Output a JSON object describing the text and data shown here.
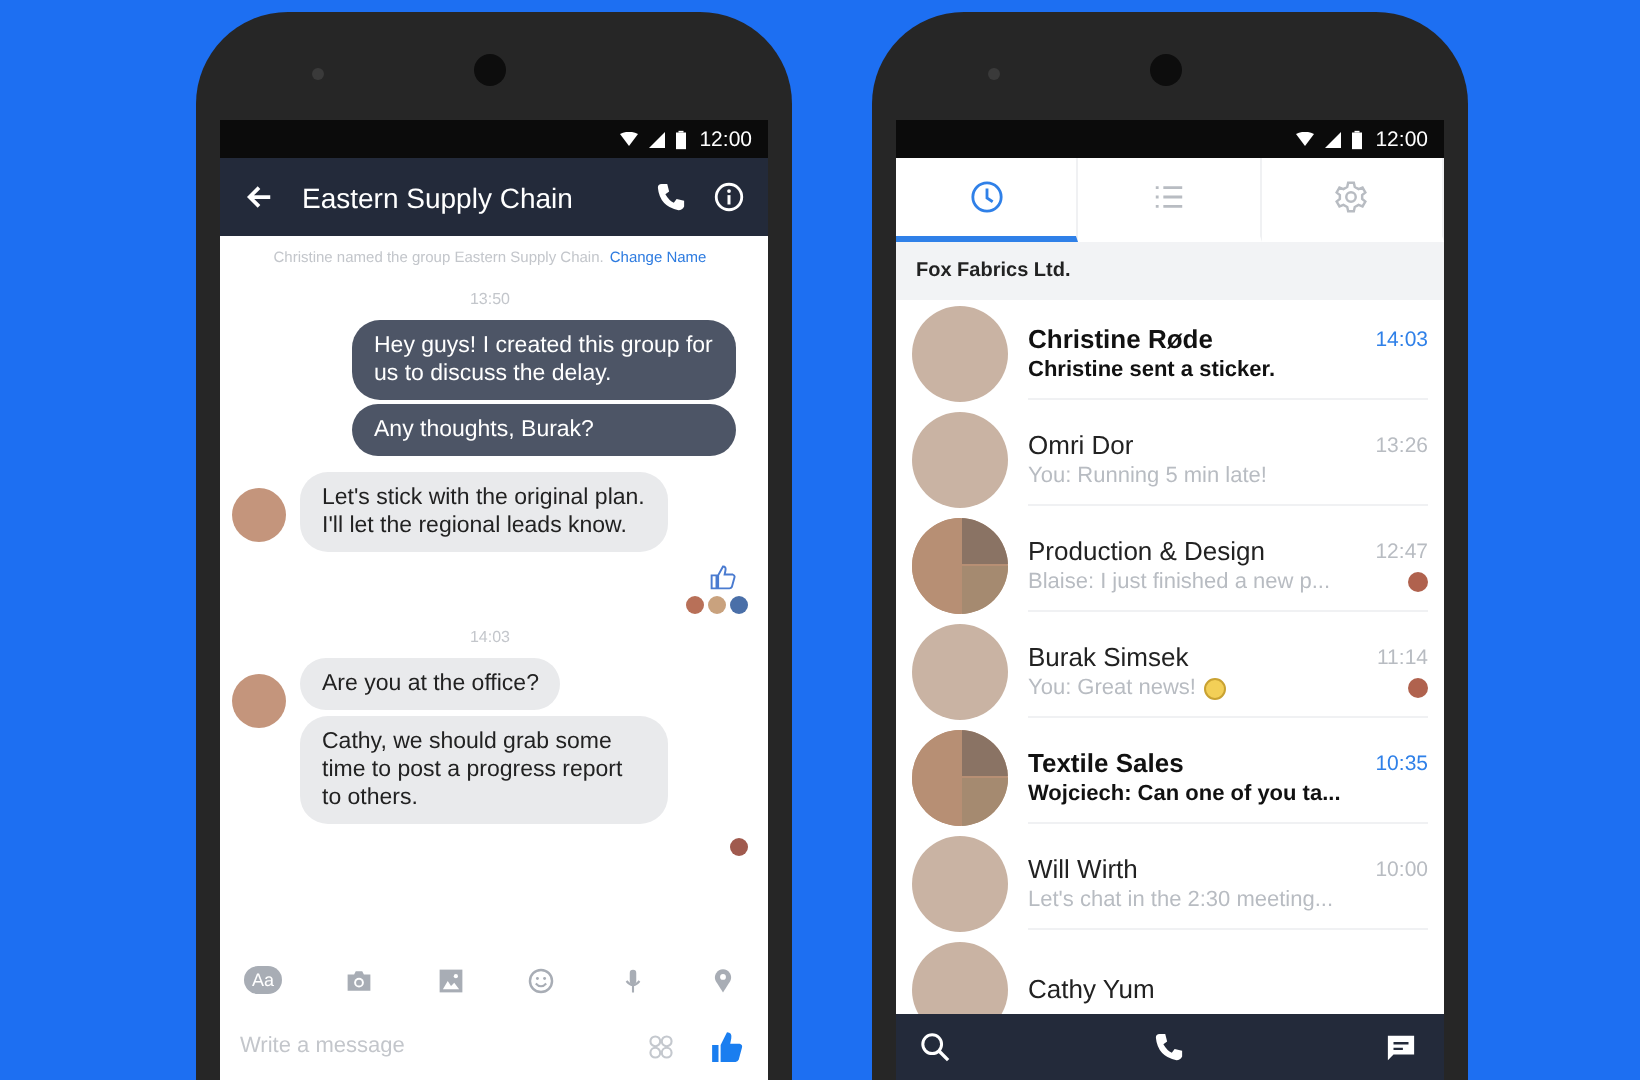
{
  "chat_screen": {
    "status_time": "12:00",
    "title": "Eastern Supply Chain",
    "items": [
      {
        "kind": "note",
        "text": "Christine named the group Eastern Supply Chain.",
        "link": "Change Name"
      },
      {
        "kind": "time",
        "text": "13:50"
      },
      {
        "kind": "outgoing",
        "bubbles": [
          "Hey guys! I created this group for us to discuss the delay.",
          "Any thoughts, Burak?"
        ]
      },
      {
        "kind": "incoming",
        "bubbles": [
          "Let's stick with the original plan. I'll let the regional leads know."
        ]
      },
      {
        "kind": "like"
      },
      {
        "kind": "seen",
        "readers": [
          {
            "color": "#b87058"
          },
          {
            "color": "#c9a27e"
          },
          {
            "color": "#4a6fa8"
          }
        ]
      },
      {
        "kind": "time",
        "text": "14:03"
      },
      {
        "kind": "incoming",
        "bubbles": [
          "Are you at the office?",
          "Cathy, we should grab some time to post a progress report to others."
        ]
      },
      {
        "kind": "seen",
        "readers": [
          {
            "color": "#a05a4e"
          }
        ]
      }
    ],
    "composer": {
      "format_label": "Aa",
      "placeholder": "Write a message"
    }
  },
  "inbox_screen": {
    "status_time": "12:00",
    "tabs": [
      {
        "kind": "recent",
        "selected": true
      },
      {
        "kind": "list",
        "selected": false
      },
      {
        "kind": "settings",
        "selected": false
      }
    ],
    "section": "Fox Fabrics Ltd.",
    "threads": [
      {
        "name": "Christine Røde",
        "preview": "Christine sent a sticker.",
        "time": "14:03",
        "unread": true,
        "kind": "single",
        "seen": false,
        "sticker": false
      },
      {
        "name": "Omri Dor",
        "preview": "You: Running 5 min late!",
        "time": "13:26",
        "unread": false,
        "kind": "single",
        "seen": false,
        "sticker": false
      },
      {
        "name": "Production & Design",
        "preview": "Blaise: I just finished a new p...",
        "time": "12:47",
        "unread": false,
        "kind": "group",
        "seen": true,
        "sticker": false
      },
      {
        "name": "Burak Simsek",
        "preview": "You: Great news!",
        "time": "11:14",
        "unread": false,
        "kind": "single",
        "seen": true,
        "sticker": true
      },
      {
        "name": "Textile Sales",
        "preview": "Wojciech: Can one of you ta...",
        "time": "10:35",
        "unread": true,
        "kind": "group",
        "seen": false,
        "sticker": false
      },
      {
        "name": "Will Wirth",
        "preview": "Let's chat in the 2:30 meeting...",
        "time": "10:00",
        "unread": false,
        "kind": "single",
        "seen": false,
        "sticker": false
      },
      {
        "name": "Cathy Yum",
        "unread": false,
        "kind": "single",
        "seen": false,
        "sticker": false
      }
    ]
  }
}
